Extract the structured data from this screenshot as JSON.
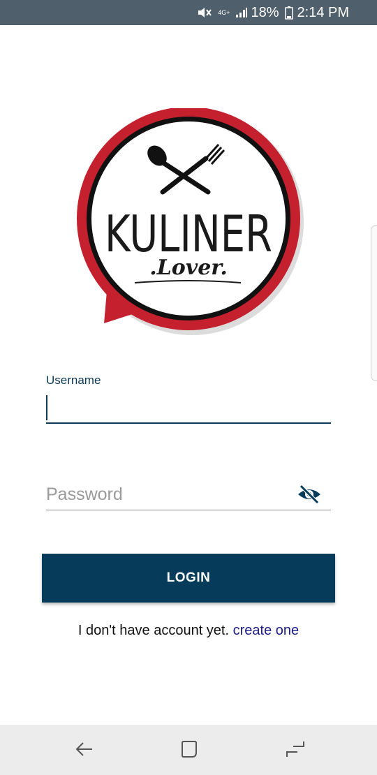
{
  "status_bar": {
    "network": "4G+",
    "battery": "18%",
    "time": "2:14 PM"
  },
  "logo": {
    "title": "KULINER",
    "subtitle": ".Lover.",
    "colors": {
      "ring": "#c4202e",
      "inner_ring": "#111111",
      "text": "#1a1a1a"
    }
  },
  "form": {
    "username_label": "Username",
    "username_value": "",
    "password_placeholder": "Password",
    "password_value": "",
    "login_label": "LOGIN"
  },
  "signup": {
    "prompt": "I don't have account yet.",
    "link": "create one"
  },
  "colors": {
    "primary": "#063b59",
    "status_bar": "#4f5f6b",
    "link": "#1b1b8a"
  },
  "icons": {
    "visibility_toggle": "eye-off-icon",
    "nav_back": "back-arrow-icon",
    "nav_home": "home-square-icon",
    "nav_recents": "recents-icon"
  }
}
